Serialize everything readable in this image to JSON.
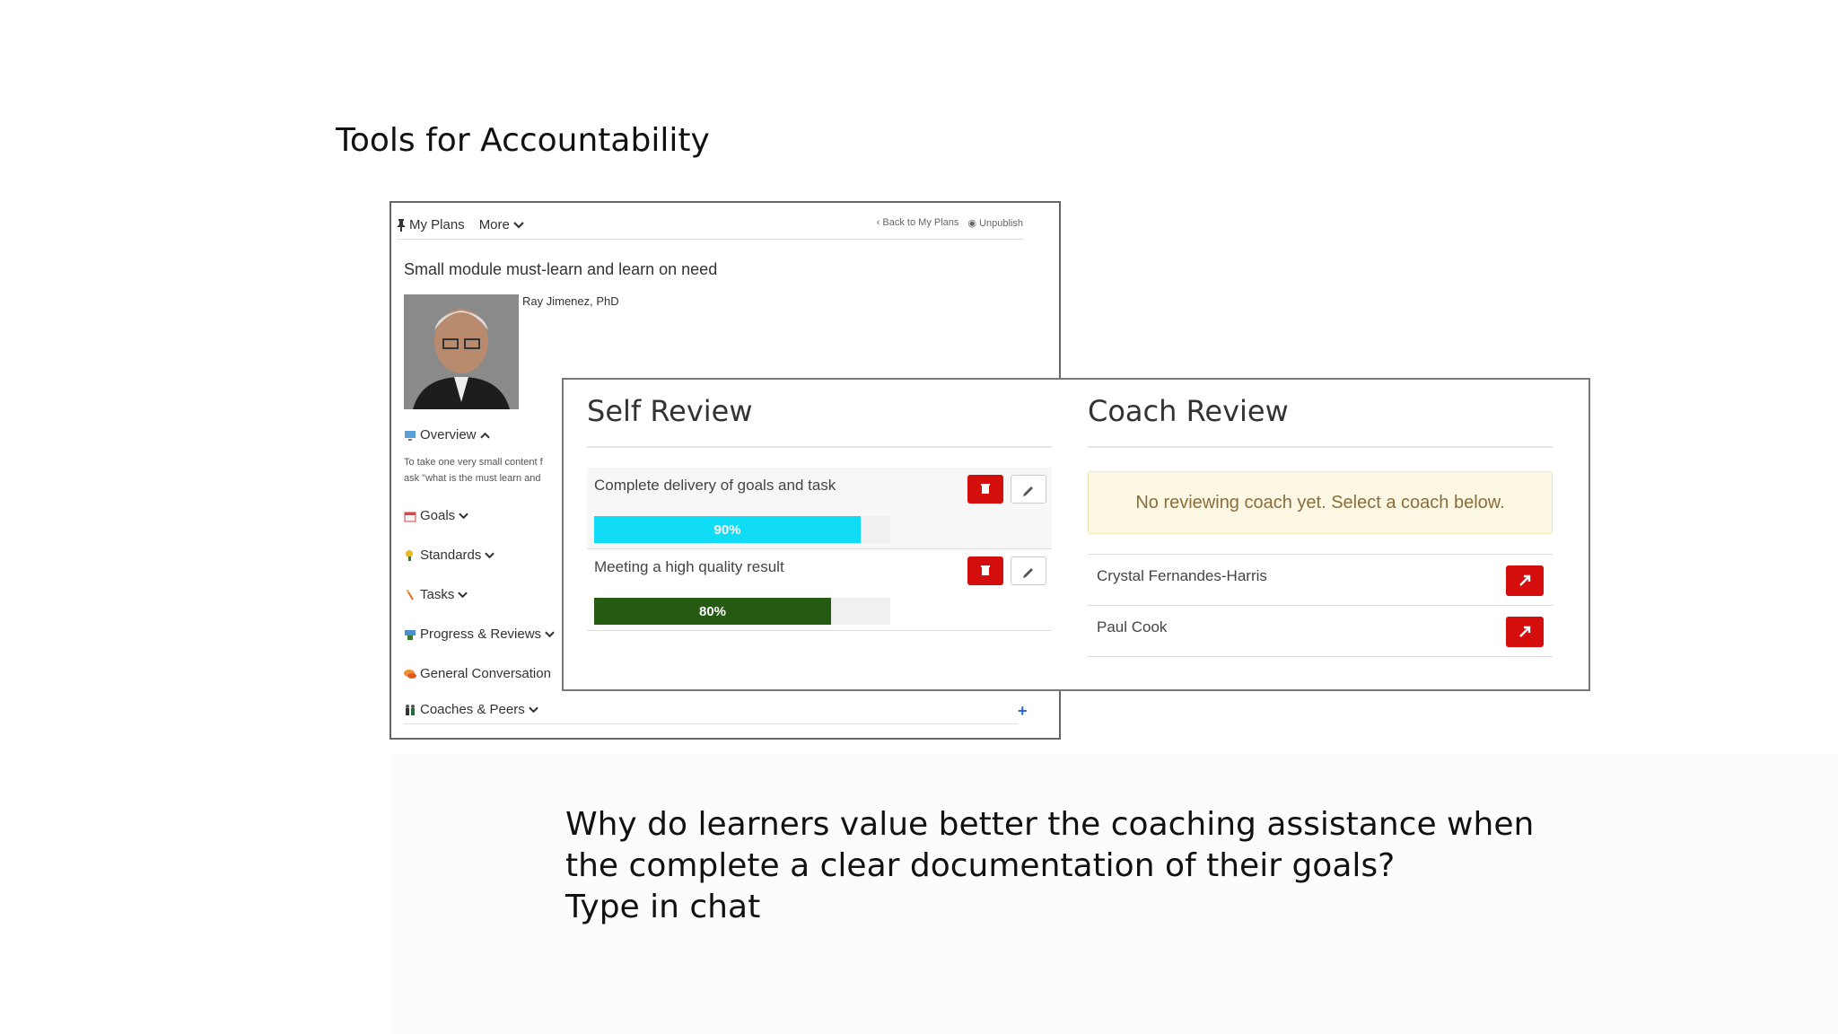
{
  "slide": {
    "title": "Tools for Accountability",
    "question_lines": [
      "Why do learners value better the coaching assistance when",
      "the complete a clear documentation of their goals?",
      "Type in chat"
    ]
  },
  "plan": {
    "nav": {
      "my_plans": "My Plans",
      "more": "More",
      "back": "Back to My Plans",
      "unpublish": "Unpublish"
    },
    "title": "Small module must-learn and learn on need",
    "author": "Ray Jimenez, PhD",
    "overview_label": "Overview",
    "overview_text_1": "To take one very small content f",
    "overview_text_2": "ask \"what is the must learn and",
    "menu": [
      {
        "label": "Goals",
        "icon": "calendar-icon"
      },
      {
        "label": "Standards",
        "icon": "trophy-icon"
      },
      {
        "label": "Tasks",
        "icon": "checklist-icon"
      },
      {
        "label": "Progress & Reviews",
        "icon": "review-icon"
      },
      {
        "label": "General Conversation",
        "icon": "chat-icon"
      },
      {
        "label": "Coaches & Peers",
        "icon": "people-icon"
      }
    ],
    "add_symbol": "+"
  },
  "review": {
    "self_title": "Self Review",
    "coach_title": "Coach Review",
    "goals": [
      {
        "label": "Complete delivery of goals and task",
        "progress": 0.9,
        "progress_label": "90%",
        "color": "#10dcf5"
      },
      {
        "label": "Meeting a high quality result",
        "progress": 0.8,
        "progress_label": "80%",
        "color": "#255a12"
      }
    ],
    "notice": "No reviewing coach yet. Select a coach below.",
    "coaches": [
      "Crystal Fernandes-Harris",
      "Paul Cook"
    ]
  },
  "colors": {
    "danger": "#d40d0d",
    "notice_bg": "#fcf8e3",
    "notice_text": "#8a6d3b"
  }
}
